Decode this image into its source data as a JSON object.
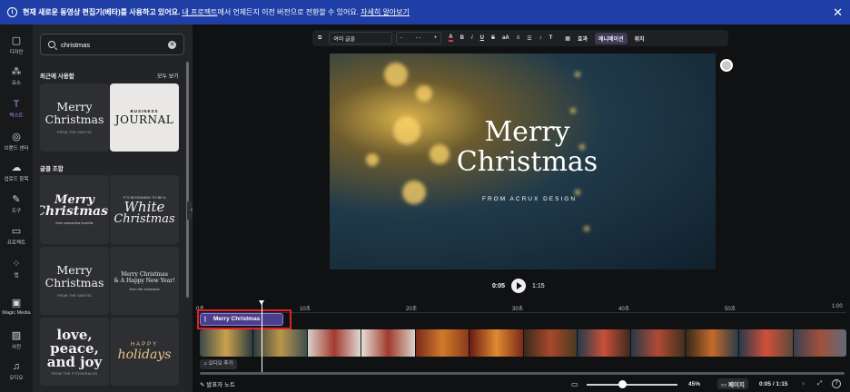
{
  "banner": {
    "info_icon": "i",
    "text_bold": "현재 새로운 동영상 편집기(베타)를 사용하고 있어요.",
    "text_link1": "내 프로젝트",
    "text_mid": "에서 언제든지 이전 버전으로 전환할 수 있어요.",
    "text_link2": "자세히 알아보기",
    "close": "✕"
  },
  "rail": {
    "items": [
      {
        "label": "디자인",
        "icon": "▢"
      },
      {
        "label": "요소",
        "icon": "⁂"
      },
      {
        "label": "텍스트",
        "icon": "T"
      },
      {
        "label": "브랜드 센터",
        "icon": "◎"
      },
      {
        "label": "업로드 항목",
        "icon": "☁"
      },
      {
        "label": "도구",
        "icon": "✎"
      },
      {
        "label": "프로젝트",
        "icon": "▭"
      },
      {
        "label": "앱",
        "icon": "⁘"
      },
      {
        "label": "Magic Media",
        "icon": "▣"
      },
      {
        "label": "사진",
        "icon": "▨"
      },
      {
        "label": "오디오",
        "icon": "♫"
      }
    ]
  },
  "panel": {
    "search_value": "christmas",
    "recent_title": "최근에 사용함",
    "see_all": "모두 보기",
    "combo_title": "글꼴 조합",
    "tiles": {
      "recent1_line1": "Merry",
      "recent1_line2": "Christmas",
      "recent1_sub": "FROM THE SMITHS",
      "recent2_top": "BUSINESS",
      "recent2_main": "JOURNAL",
      "combo1_line1": "Merry",
      "combo1_line2": "Christmas!",
      "combo1_sub": "from samantha howells",
      "combo2_top": "IT'S BEGINNING TO BE A",
      "combo2_line1": "White",
      "combo2_line2": "Christmas",
      "combo3_line1": "Merry",
      "combo3_line2": "Christmas",
      "combo3_sub": "FROM THE SMITHS",
      "combo4_line1": "Merry Christmas",
      "combo4_line2": "& A Happy New Year!",
      "combo4_sub": "from the Johnsons",
      "combo5_line1": "love,",
      "combo5_line2": "peace,",
      "combo5_line3": "and joy",
      "combo5_sub": "FROM THE FITZGERALDS",
      "combo6_top": "HAPPY",
      "combo6_main": "holidays"
    }
  },
  "toolbar": {
    "font": "여러 글꼴",
    "size": "- -",
    "minus": "-",
    "plus": "+",
    "color_letter": "A",
    "bold": "B",
    "italic": "I",
    "underline": "U",
    "strike": "S",
    "case": "aA",
    "align": "≡",
    "list": "☰",
    "spacing": "↕",
    "vertical": "T",
    "checker": "▦",
    "effects": "효과",
    "animate": "애니메이션",
    "position": "위치"
  },
  "canvas": {
    "title_line1": "Merry",
    "title_line2": "Christmas",
    "subtitle": "FROM ACRUX DESIGN"
  },
  "player": {
    "current": "0:05",
    "total": "1:15"
  },
  "timeline": {
    "ticks": [
      "0초",
      "10초",
      "20초",
      "30초",
      "40초",
      "50초",
      "1:00"
    ],
    "text_clip": "Merry Christmas",
    "audio_button": "오디오 추가"
  },
  "bottom": {
    "notes": "발표자 노트",
    "zoom": "45%",
    "pages": "페이지",
    "time": "0:05 / 1:15",
    "help": "?"
  }
}
